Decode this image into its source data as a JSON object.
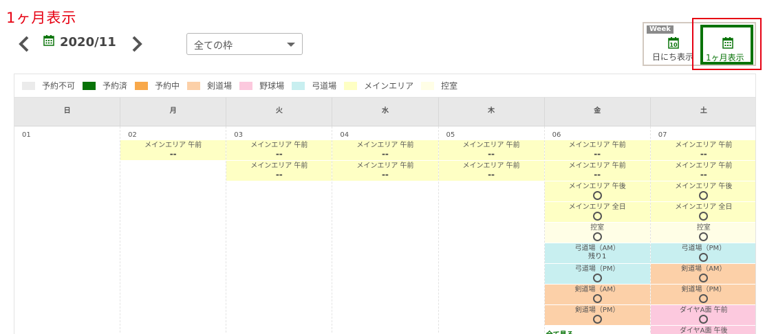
{
  "page_title": "1ヶ月表示",
  "nav": {
    "month": "2020/11"
  },
  "filter": {
    "selected": "全ての枠"
  },
  "view_switch": {
    "week_tag": "Week",
    "week_icon_day": "10",
    "week_label": "日にち表示",
    "month_label": "1ヶ月表示"
  },
  "colors": {
    "unavailable": "#ebebeb",
    "booked": "#087308",
    "pending": "#f8a84a",
    "kendo": "#fcd0a8",
    "baseball": "#fcc9de",
    "kyudo": "#c8eff0",
    "main": "#feffc4",
    "waiting": "#fffee6",
    "accent_red": "#e60012"
  },
  "legend": [
    {
      "label": "予約不可",
      "color": "#ebebeb"
    },
    {
      "label": "予約済",
      "color": "#087308"
    },
    {
      "label": "予約中",
      "color": "#f8a84a"
    },
    {
      "label": "剣道場",
      "color": "#fcd0a8"
    },
    {
      "label": "野球場",
      "color": "#fcc9de"
    },
    {
      "label": "弓道場",
      "color": "#c8eff0"
    },
    {
      "label": "メインエリア",
      "color": "#feffc4"
    },
    {
      "label": "控室",
      "color": "#fffee6"
    }
  ],
  "weekdays": [
    "日",
    "月",
    "火",
    "水",
    "木",
    "金",
    "土"
  ],
  "days": [
    {
      "num": "01",
      "slots": []
    },
    {
      "num": "02",
      "slots": [
        {
          "name": "メインエリア 午前",
          "status": "--",
          "color": "#feffc4"
        }
      ]
    },
    {
      "num": "03",
      "slots": [
        {
          "name": "メインエリア 午前",
          "status": "--",
          "color": "#feffc4"
        },
        {
          "name": "メインエリア 午前",
          "status": "--",
          "color": "#feffc4"
        }
      ]
    },
    {
      "num": "04",
      "slots": [
        {
          "name": "メインエリア 午前",
          "status": "--",
          "color": "#feffc4"
        },
        {
          "name": "メインエリア 午前",
          "status": "--",
          "color": "#feffc4"
        }
      ]
    },
    {
      "num": "05",
      "slots": [
        {
          "name": "メインエリア 午前",
          "status": "--",
          "color": "#feffc4"
        },
        {
          "name": "メインエリア 午前",
          "status": "--",
          "color": "#feffc4"
        }
      ]
    },
    {
      "num": "06",
      "slots": [
        {
          "name": "メインエリア 午前",
          "status": "--",
          "color": "#feffc4"
        },
        {
          "name": "メインエリア 午前",
          "status": "--",
          "color": "#feffc4"
        },
        {
          "name": "メインエリア 午後",
          "status": "○",
          "color": "#feffc4"
        },
        {
          "name": "メインエリア 全日",
          "status": "○",
          "color": "#feffc4"
        },
        {
          "name": "控室",
          "status": "○",
          "color": "#fffee6"
        },
        {
          "name": "弓道場（AM）",
          "status": "残り1",
          "color": "#c8eff0"
        },
        {
          "name": "弓道場（PM）",
          "status": "○",
          "color": "#c8eff0"
        },
        {
          "name": "剣道場（AM）",
          "status": "○",
          "color": "#fcd0a8"
        },
        {
          "name": "剣道場（PM）",
          "status": "○",
          "color": "#fcd0a8"
        }
      ],
      "see_all": "全て見る"
    },
    {
      "num": "07",
      "slots": [
        {
          "name": "メインエリア 午前",
          "status": "--",
          "color": "#feffc4"
        },
        {
          "name": "メインエリア 午前",
          "status": "--",
          "color": "#feffc4"
        },
        {
          "name": "メインエリア 午後",
          "status": "○",
          "color": "#feffc4"
        },
        {
          "name": "メインエリア 全日",
          "status": "○",
          "color": "#feffc4"
        },
        {
          "name": "控室",
          "status": "○",
          "color": "#fffee6"
        },
        {
          "name": "弓道場（PM）",
          "status": "○",
          "color": "#c8eff0"
        },
        {
          "name": "剣道場（AM）",
          "status": "○",
          "color": "#fcd0a8"
        },
        {
          "name": "剣道場（PM）",
          "status": "○",
          "color": "#fcd0a8"
        },
        {
          "name": "ダイヤA面 午前",
          "status": "○",
          "color": "#fcc9de"
        },
        {
          "name": "ダイヤA面 午後",
          "status": "",
          "color": "#fcc9de"
        }
      ]
    }
  ]
}
